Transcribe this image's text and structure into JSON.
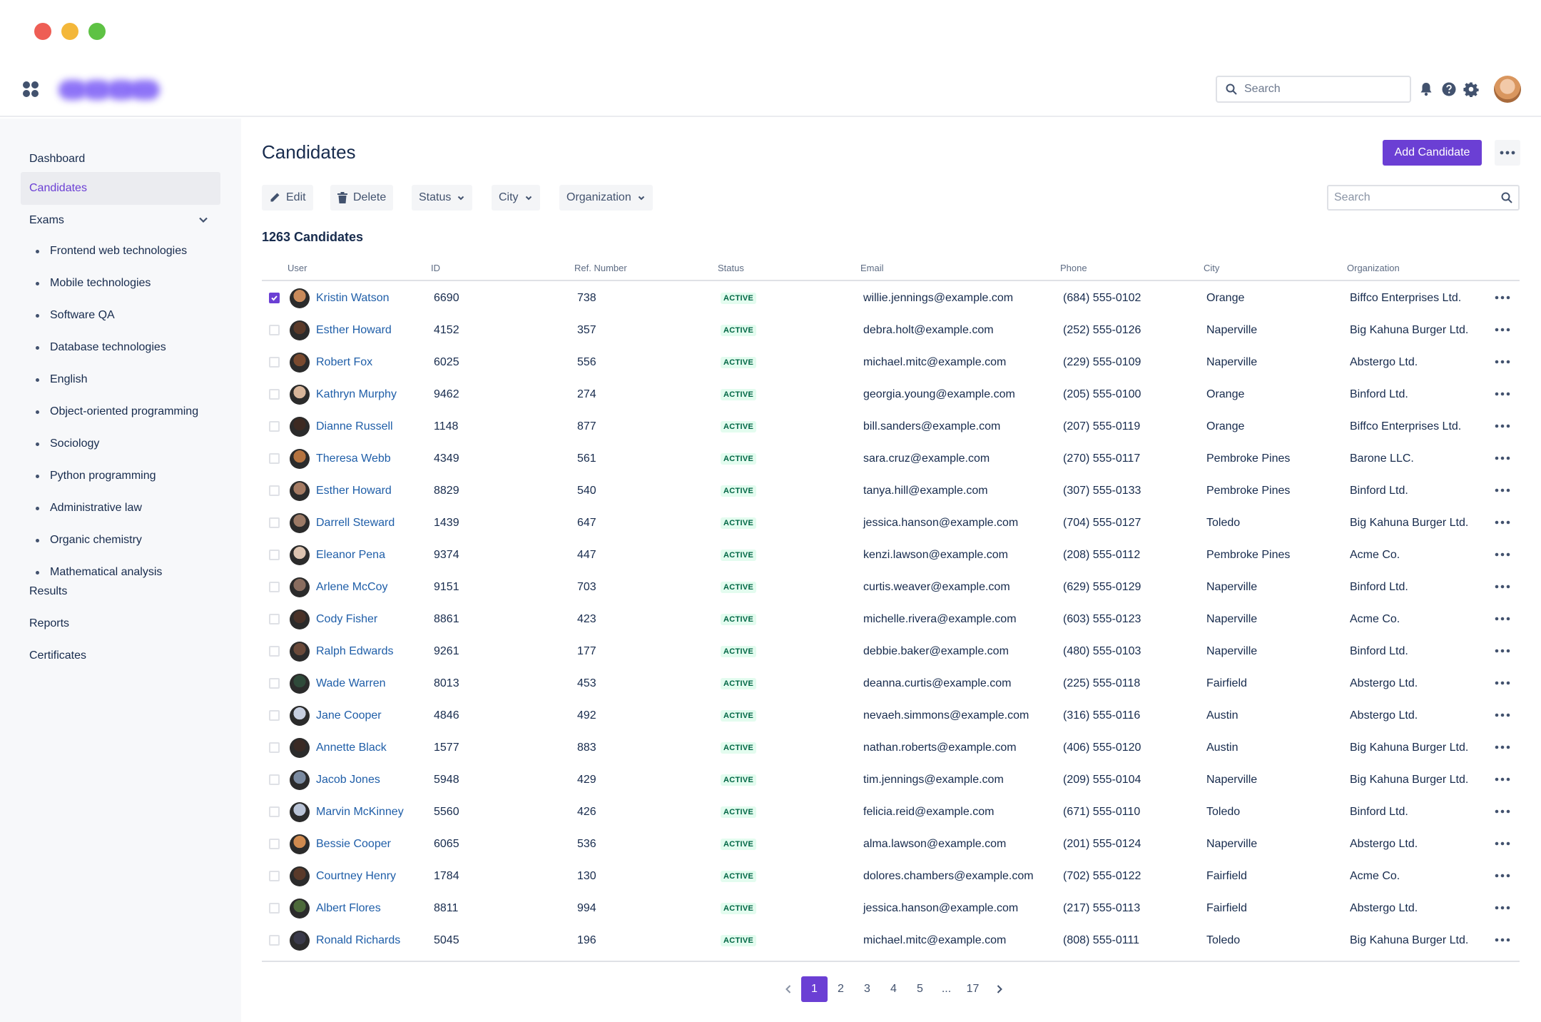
{
  "header": {
    "search_placeholder": "Search"
  },
  "colors": {
    "accent": "#6b3fd4",
    "link": "#1f5ea8",
    "active_badge_bg": "#e3fcef",
    "active_badge_text": "#006644"
  },
  "sidebar": {
    "items": [
      {
        "label": "Dashboard"
      },
      {
        "label": "Candidates"
      },
      {
        "label": "Exams"
      },
      {
        "label": "Results"
      },
      {
        "label": "Reports"
      },
      {
        "label": "Certificates"
      }
    ],
    "exams": [
      "Frontend web technologies",
      "Mobile technologies",
      "Software QA",
      "Database technologies",
      "English",
      "Object-oriented programming",
      "Sociology",
      "Python programming",
      "Administrative law",
      "Organic chemistry",
      "Mathematical analysis"
    ]
  },
  "page": {
    "title": "Candidates",
    "add_label": "Add Candidate",
    "count_label": "1263 Candidates"
  },
  "toolbar": {
    "edit": "Edit",
    "delete": "Delete",
    "status": "Status",
    "city": "City",
    "organization": "Organization",
    "search_placeholder": "Search"
  },
  "table": {
    "columns": [
      "User",
      "ID",
      "Ref. Number",
      "Status",
      "Email",
      "Phone",
      "City",
      "Organization"
    ],
    "rows": [
      {
        "name": "Kristin Watson",
        "id": "6690",
        "ref": "738",
        "status": "ACTIVE",
        "email": "willie.jennings@example.com",
        "phone": "(684) 555-0102",
        "city": "Orange",
        "org": "Biffco Enterprises Ltd.",
        "checked": true
      },
      {
        "name": "Esther Howard",
        "id": "4152",
        "ref": "357",
        "status": "ACTIVE",
        "email": "debra.holt@example.com",
        "phone": "(252) 555-0126",
        "city": "Naperville",
        "org": "Big Kahuna Burger Ltd.",
        "checked": false
      },
      {
        "name": "Robert Fox",
        "id": "6025",
        "ref": "556",
        "status": "ACTIVE",
        "email": "michael.mitc@example.com",
        "phone": "(229) 555-0109",
        "city": "Naperville",
        "org": "Abstergo Ltd.",
        "checked": false
      },
      {
        "name": "Kathryn Murphy",
        "id": "9462",
        "ref": "274",
        "status": "ACTIVE",
        "email": "georgia.young@example.com",
        "phone": "(205) 555-0100",
        "city": "Orange",
        "org": "Binford Ltd.",
        "checked": false
      },
      {
        "name": "Dianne Russell",
        "id": "1148",
        "ref": "877",
        "status": "ACTIVE",
        "email": "bill.sanders@example.com",
        "phone": "(207) 555-0119",
        "city": "Orange",
        "org": "Biffco Enterprises Ltd.",
        "checked": false
      },
      {
        "name": "Theresa Webb",
        "id": "4349",
        "ref": "561",
        "status": "ACTIVE",
        "email": "sara.cruz@example.com",
        "phone": "(270) 555-0117",
        "city": "Pembroke Pines",
        "org": "Barone LLC.",
        "checked": false
      },
      {
        "name": "Esther Howard",
        "id": "8829",
        "ref": "540",
        "status": "ACTIVE",
        "email": "tanya.hill@example.com",
        "phone": "(307) 555-0133",
        "city": "Pembroke Pines",
        "org": "Binford Ltd.",
        "checked": false
      },
      {
        "name": "Darrell Steward",
        "id": "1439",
        "ref": "647",
        "status": "ACTIVE",
        "email": "jessica.hanson@example.com",
        "phone": "(704) 555-0127",
        "city": "Toledo",
        "org": "Big Kahuna Burger Ltd.",
        "checked": false
      },
      {
        "name": "Eleanor Pena",
        "id": "9374",
        "ref": "447",
        "status": "ACTIVE",
        "email": "kenzi.lawson@example.com",
        "phone": "(208) 555-0112",
        "city": "Pembroke Pines",
        "org": "Acme Co.",
        "checked": false
      },
      {
        "name": "Arlene McCoy",
        "id": "9151",
        "ref": "703",
        "status": "ACTIVE",
        "email": "curtis.weaver@example.com",
        "phone": "(629) 555-0129",
        "city": "Naperville",
        "org": "Binford Ltd.",
        "checked": false
      },
      {
        "name": "Cody Fisher",
        "id": "8861",
        "ref": "423",
        "status": "ACTIVE",
        "email": "michelle.rivera@example.com",
        "phone": "(603) 555-0123",
        "city": "Naperville",
        "org": "Acme Co.",
        "checked": false
      },
      {
        "name": "Ralph Edwards",
        "id": "9261",
        "ref": "177",
        "status": "ACTIVE",
        "email": "debbie.baker@example.com",
        "phone": "(480) 555-0103",
        "city": "Naperville",
        "org": "Binford Ltd.",
        "checked": false
      },
      {
        "name": "Wade Warren",
        "id": "8013",
        "ref": "453",
        "status": "ACTIVE",
        "email": "deanna.curtis@example.com",
        "phone": "(225) 555-0118",
        "city": "Fairfield",
        "org": "Abstergo Ltd.",
        "checked": false
      },
      {
        "name": "Jane Cooper",
        "id": "4846",
        "ref": "492",
        "status": "ACTIVE",
        "email": "nevaeh.simmons@example.com",
        "phone": "(316) 555-0116",
        "city": "Austin",
        "org": "Abstergo Ltd.",
        "checked": false
      },
      {
        "name": "Annette Black",
        "id": "1577",
        "ref": "883",
        "status": "ACTIVE",
        "email": "nathan.roberts@example.com",
        "phone": "(406) 555-0120",
        "city": "Austin",
        "org": "Big Kahuna Burger Ltd.",
        "checked": false
      },
      {
        "name": "Jacob Jones",
        "id": "5948",
        "ref": "429",
        "status": "ACTIVE",
        "email": "tim.jennings@example.com",
        "phone": "(209) 555-0104",
        "city": "Naperville",
        "org": "Big Kahuna Burger Ltd.",
        "checked": false
      },
      {
        "name": "Marvin McKinney",
        "id": "5560",
        "ref": "426",
        "status": "ACTIVE",
        "email": "felicia.reid@example.com",
        "phone": "(671) 555-0110",
        "city": "Toledo",
        "org": "Binford Ltd.",
        "checked": false
      },
      {
        "name": "Bessie Cooper",
        "id": "6065",
        "ref": "536",
        "status": "ACTIVE",
        "email": "alma.lawson@example.com",
        "phone": "(201) 555-0124",
        "city": "Naperville",
        "org": "Abstergo Ltd.",
        "checked": false
      },
      {
        "name": "Courtney Henry",
        "id": "1784",
        "ref": "130",
        "status": "ACTIVE",
        "email": "dolores.chambers@example.com",
        "phone": "(702) 555-0122",
        "city": "Fairfield",
        "org": "Acme Co.",
        "checked": false
      },
      {
        "name": "Albert Flores",
        "id": "8811",
        "ref": "994",
        "status": "ACTIVE",
        "email": "jessica.hanson@example.com",
        "phone": "(217) 555-0113",
        "city": "Fairfield",
        "org": "Abstergo Ltd.",
        "checked": false
      },
      {
        "name": "Ronald Richards",
        "id": "5045",
        "ref": "196",
        "status": "ACTIVE",
        "email": "michael.mitc@example.com",
        "phone": "(808) 555-0111",
        "city": "Toledo",
        "org": "Big Kahuna Burger Ltd.",
        "checked": false
      }
    ]
  },
  "pagination": {
    "pages": [
      "1",
      "2",
      "3",
      "4",
      "5",
      "...",
      "17"
    ],
    "current": "1"
  }
}
